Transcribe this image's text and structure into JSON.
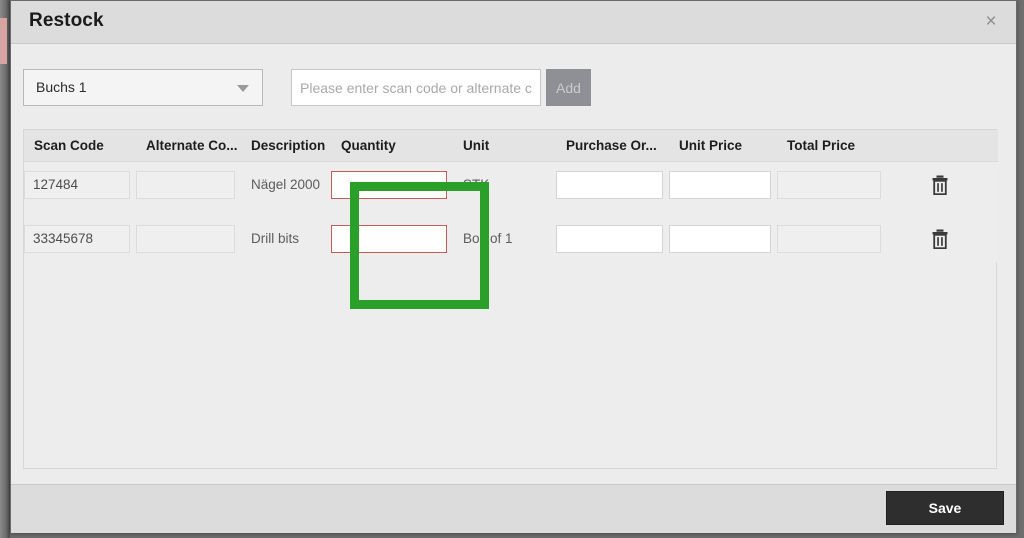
{
  "modal": {
    "title": "Restock",
    "close_icon": "close-icon",
    "close_label": "×"
  },
  "toolbar": {
    "location_select": {
      "value": "Buchs 1",
      "caret_icon": "chevron-down-icon"
    },
    "scan_field": {
      "value": "",
      "placeholder": "Please enter scan code or alternate code"
    },
    "add_button": {
      "label": "Add",
      "enabled": false
    }
  },
  "table": {
    "columns": [
      {
        "key": "scan_code",
        "label": "Scan Code"
      },
      {
        "key": "alternate_code",
        "label": "Alternate Co..."
      },
      {
        "key": "description",
        "label": "Description"
      },
      {
        "key": "quantity",
        "label": "Quantity"
      },
      {
        "key": "unit",
        "label": "Unit"
      },
      {
        "key": "purchase_order",
        "label": "Purchase Or..."
      },
      {
        "key": "unit_price",
        "label": "Unit Price"
      },
      {
        "key": "total_price",
        "label": "Total Price"
      },
      {
        "key": "delete",
        "label": ""
      }
    ],
    "rows": [
      {
        "scan_code": "127484",
        "alternate_code": "",
        "description": "Nägel 2000",
        "quantity": "",
        "unit": "STK",
        "purchase_order": "",
        "unit_price": "",
        "total_price": "",
        "delete_icon": "trash-icon"
      },
      {
        "scan_code": "33345678",
        "alternate_code": "",
        "description": "Drill bits",
        "quantity": "",
        "unit": "Box of 1",
        "purchase_order": "",
        "unit_price": "",
        "total_price": "",
        "delete_icon": "trash-icon"
      }
    ]
  },
  "footer": {
    "save_label": "Save"
  },
  "annotation": {
    "target": "quantity-column",
    "color": "#2aa02a"
  },
  "colors": {
    "titlebar": "#dcdcdc",
    "body": "#ececec",
    "invalid_border": "#c65a5c",
    "save_bg": "#2e2e2e",
    "add_bg": "#8e9095",
    "highlight": "#2aa02a"
  }
}
